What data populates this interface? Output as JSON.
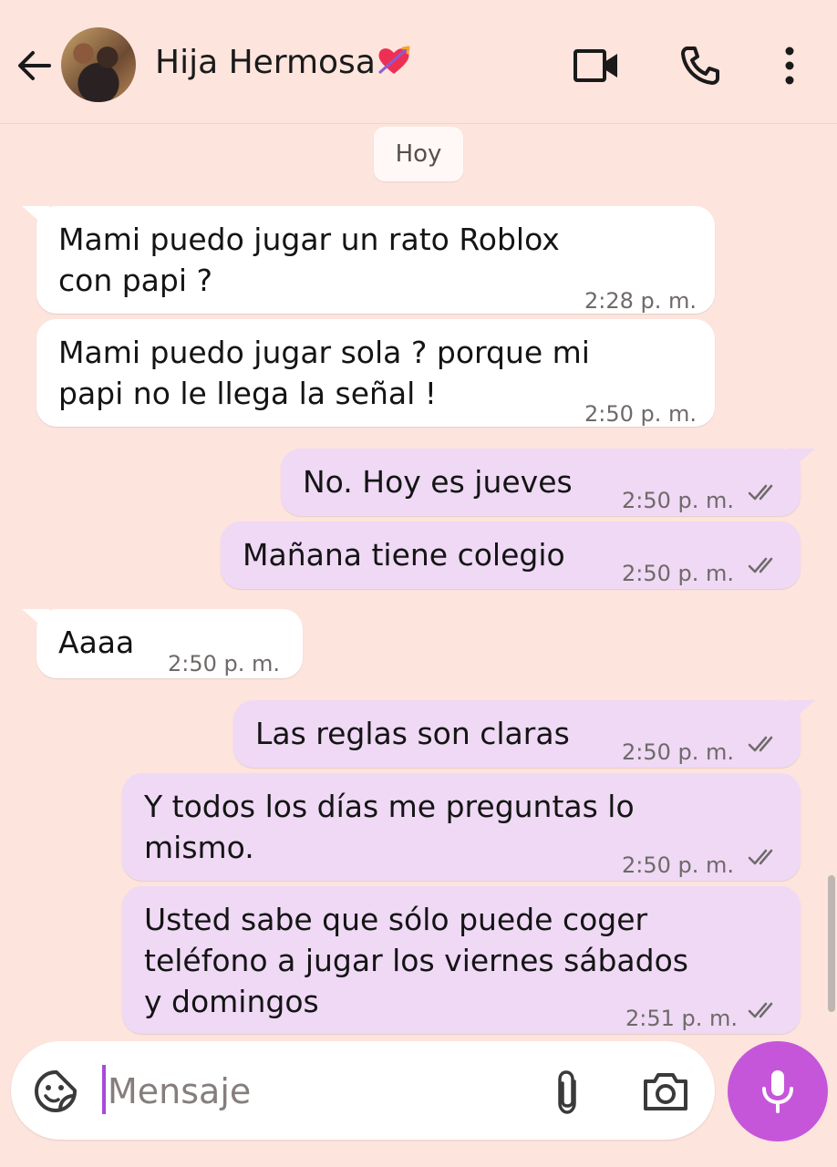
{
  "header": {
    "contact_name": "Hija Hermosa",
    "back_icon": "arrow-left-icon",
    "heart_icon": "heart-with-arrow-icon",
    "video_icon": "video-camera-icon",
    "call_icon": "phone-icon",
    "more_icon": "more-vertical-icon"
  },
  "date_chip": "Hoy",
  "messages": [
    {
      "dir": "in",
      "text": "Mami puedo jugar un rato Roblox\ncon papi ?",
      "time": "2:28 p. m."
    },
    {
      "dir": "in",
      "text": "Mami puedo jugar sola ?  porque mi\npapi no le llega la señal !",
      "time": "2:50 p. m."
    },
    {
      "dir": "out",
      "text": "No. Hoy es jueves",
      "time": "2:50 p. m.",
      "status": "read"
    },
    {
      "dir": "out",
      "text": "Mañana tiene colegio",
      "time": "2:50 p. m.",
      "status": "read"
    },
    {
      "dir": "in",
      "text": "Aaaa",
      "time": "2:50 p. m."
    },
    {
      "dir": "out",
      "text": "Las reglas son claras",
      "time": "2:50 p. m.",
      "status": "read"
    },
    {
      "dir": "out",
      "text": "Y todos los días me preguntas lo\nmismo.",
      "time": "2:50 p. m.",
      "status": "read"
    },
    {
      "dir": "out",
      "text": "Usted sabe que sólo puede coger\nteléfono a jugar los viernes sábados\ny domingos",
      "time": "2:51 p. m.",
      "status": "read"
    }
  ],
  "composer": {
    "placeholder": "Mensaje",
    "value": "",
    "emoji_icon": "sticker-icon",
    "attach_icon": "paperclip-icon",
    "camera_icon": "camera-icon",
    "mic_icon": "microphone-icon"
  },
  "colors": {
    "background": "#fde4dd",
    "incoming_bubble": "#ffffff",
    "outgoing_bubble": "#efd9f5",
    "mic_button": "#c556da",
    "cursor": "#a64bd6"
  }
}
